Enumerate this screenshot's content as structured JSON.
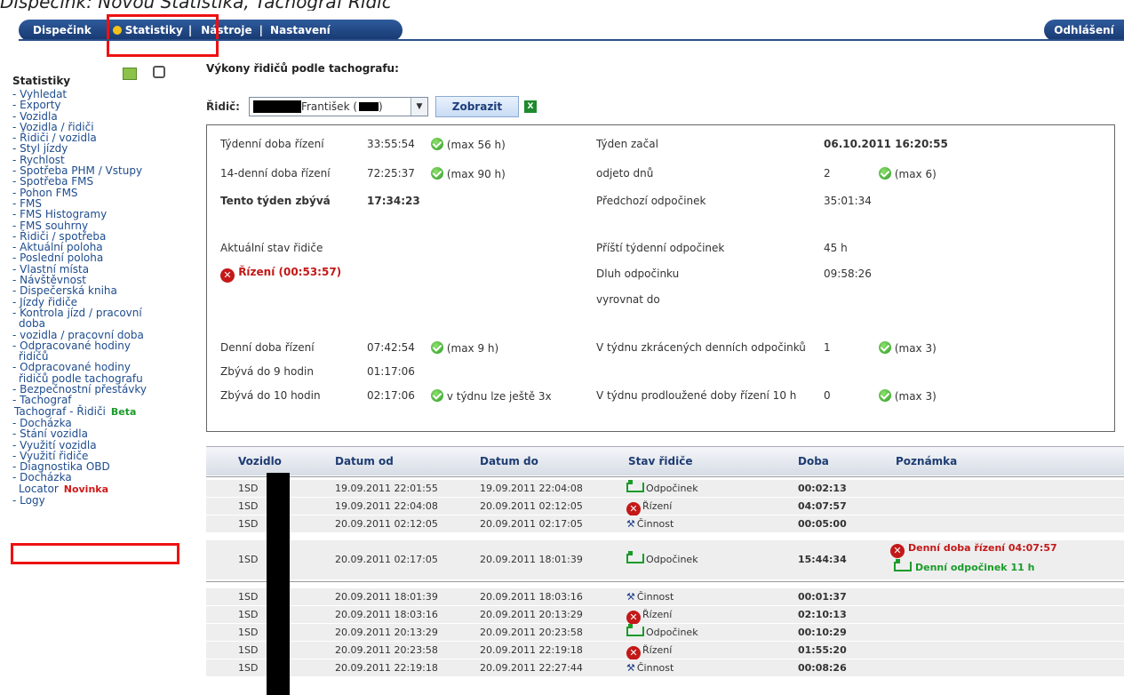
{
  "caption": "Dispečink: Novou Statistika, Tachograf Řidič",
  "nav": {
    "items": [
      "Dispečink",
      "Statistiky",
      "Nástroje",
      "Nastavení"
    ],
    "separator": "|",
    "logout": "Odhlášení"
  },
  "sidebar": {
    "title": "Statistiky",
    "items": [
      "- Vyhledat",
      "- Exporty",
      "- Vozidla",
      "- Vozidla / řidiči",
      "- Řidiči / vozidla",
      "- Styl jízdy",
      "- Rychlost",
      "- Spotřeba PHM / Vstupy",
      "- Spotřeba FMS",
      "- Pohon FMS",
      "- FMS",
      "- FMS Histogramy",
      "- FMS souhrny",
      "- Řidiči / spotřeba",
      "- Aktuální poloha",
      "- Poslední poloha",
      "- Vlastní místa",
      "- Návštěvnost",
      "- Dispečerská kniha",
      "- Jízdy řidiče",
      "- Kontrola jízd / pracovní",
      "doba",
      "- vozidla / pracovní doba",
      "- Odpracované hodiny",
      "řidičů",
      "- Odpracované hodiny",
      "řidičů podle tachografu",
      "- Bezpečnostní přestávky",
      "- Tachograf"
    ],
    "highlighted": "Tachograf - Řidiči",
    "highlighted_badge": "Beta",
    "items_after": [
      "- Docházka",
      "- Stání vozidla",
      "- Využití vozidla",
      "- Využití řidiče",
      "- Diagnostika OBD",
      "- Docházka"
    ],
    "locator": "Locator",
    "locator_badge": "Novinka",
    "last": "- Logy"
  },
  "main": {
    "heading": "Výkony řidičů podle tachografu:",
    "driver_label": "Řidič:",
    "driver_value": "František (",
    "show_button": "Zobrazit"
  },
  "summary": {
    "weekly_drive_label": "Týdenní doba řízení",
    "weekly_drive_value": "33:55:54",
    "weekly_drive_max": "(max 56 h)",
    "biweekly_label": "14-denní doba řízení",
    "biweekly_value": "72:25:37",
    "biweekly_max": "(max 90 h)",
    "remaining_label": "Tento týden zbývá",
    "remaining_value": "17:34:23",
    "week_start_label": "Týden začal",
    "week_start_value": "06.10.2011 16:20:55",
    "days_label": "odjeto dnů",
    "days_value": "2",
    "days_max": "(max 6)",
    "prev_rest_label": "Předchozí odpočinek",
    "prev_rest_value": "35:01:34",
    "state_label": "Aktuální stav řidiče",
    "state_value": "Řízení (00:53:57)",
    "next_rest_label": "Příští týdenní odpočinek",
    "next_rest_value": "45 h",
    "rest_debt_label": "Dluh odpočinku",
    "rest_debt_value": "09:58:26",
    "settle_label": "vyrovnat do",
    "daily_drive_label": "Denní doba řízení",
    "daily_drive_value": "07:42:54",
    "daily_drive_max": "(max 9 h)",
    "to9_label": "Zbývá do 9 hodin",
    "to9_value": "01:17:06",
    "to10_label": "Zbývá do 10 hodin",
    "to10_value": "02:17:06",
    "to10_note": "v týdnu lze ještě 3x",
    "reduced_label": "V týdnu zkrácených denních odpočinků",
    "reduced_value": "1",
    "reduced_max": "(max 3)",
    "extended_label": "V týdnu prodloužené doby řízení 10 h",
    "extended_value": "0",
    "extended_max": "(max 3)"
  },
  "table": {
    "headers": [
      "Vozidlo",
      "Datum od",
      "Datum do",
      "Stav řidiče",
      "Doba",
      "Poznámka"
    ],
    "rows": [
      {
        "vehicle": "1SD",
        "from": "19.09.2011 22:01:55",
        "to": "19.09.2011 22:04:08",
        "state": "Odpočinek",
        "kind": "rest",
        "dur": "00:02:13"
      },
      {
        "vehicle": "1SD",
        "from": "19.09.2011 22:04:08",
        "to": "20.09.2011 02:12:05",
        "state": "Řízení",
        "kind": "drive",
        "dur": "04:07:57"
      },
      {
        "vehicle": "1SD",
        "from": "20.09.2011 02:12:05",
        "to": "20.09.2011 02:17:05",
        "state": "Činnost",
        "kind": "work",
        "dur": "00:05:00"
      },
      {
        "vehicle": "1SD",
        "from": "20.09.2011 02:17:05",
        "to": "20.09.2011 18:01:39",
        "state": "Odpočinek",
        "kind": "rest",
        "dur": "15:44:34",
        "note1": "Denní doba řízení 04:07:57",
        "note2": "Denní odpočinek 11 h"
      },
      {
        "vehicle": "1SD",
        "from": "20.09.2011 18:01:39",
        "to": "20.09.2011 18:03:16",
        "state": "Činnost",
        "kind": "work",
        "dur": "00:01:37"
      },
      {
        "vehicle": "1SD",
        "from": "20.09.2011 18:03:16",
        "to": "20.09.2011 20:13:29",
        "state": "Řízení",
        "kind": "drive",
        "dur": "02:10:13"
      },
      {
        "vehicle": "1SD",
        "from": "20.09.2011 20:13:29",
        "to": "20.09.2011 20:23:58",
        "state": "Odpočinek",
        "kind": "rest",
        "dur": "00:10:29"
      },
      {
        "vehicle": "1SD",
        "from": "20.09.2011 20:23:58",
        "to": "20.09.2011 22:19:18",
        "state": "Řízení",
        "kind": "drive",
        "dur": "01:55:20"
      },
      {
        "vehicle": "1SD",
        "from": "20.09.2011 22:19:18",
        "to": "20.09.2011 22:27:44",
        "state": "Činnost",
        "kind": "work",
        "dur": "00:08:26"
      }
    ]
  }
}
